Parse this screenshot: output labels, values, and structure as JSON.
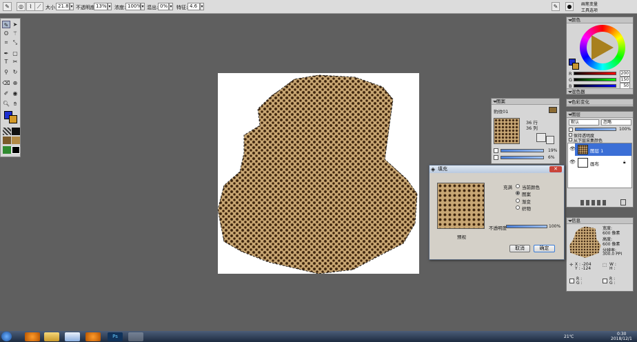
{
  "options_bar": {
    "size_label": "大小:",
    "size_value": "21.8",
    "opacity_label": "不透明度:",
    "opacity_value": "13%",
    "density_label": "浓度:",
    "density_value": "100%",
    "mix_label": "混出:",
    "mix_value": "0%",
    "feature_label": "特征:",
    "feature_value": "4.6"
  },
  "top_right": {
    "line1": "画笔变量",
    "line2": "工具选项"
  },
  "color_panel": {
    "title": "颜色",
    "r_label": "R",
    "r_value": "200",
    "g_label": "G",
    "g_value": "150",
    "b_label": "B",
    "b_value": "50",
    "mixer_label": "混色器",
    "primary_color": "#c89632"
  },
  "color_variation_panel": {
    "title": "色彩变化"
  },
  "pattern_panel": {
    "title": "图案",
    "name": "豹纹01",
    "rows": "36 行",
    "cols": "36 列",
    "slider1_value": "19%",
    "slider2_value": "6%"
  },
  "layers_panel": {
    "title": "图层",
    "blend_mode": "默认",
    "composite": "忽略",
    "opacity_value": "100%",
    "option1": "保持透明度",
    "option2": "从下层采集颜色",
    "layer1_name": "图层 1",
    "layer2_name": "画布"
  },
  "info_panel": {
    "title": "信息",
    "width_label": "宽度:",
    "width_value": "600 像素",
    "height_label": "高度:",
    "height_value": "600 像素",
    "res_label": "分辨率:",
    "res_value": "300.0 PPI",
    "x_value": "X : -204",
    "y_value": "Y : -124",
    "w_label": "W :",
    "h_label": "H :"
  },
  "dialog": {
    "title": "填充",
    "fill_label": "充满",
    "opt1": "当前颜色",
    "opt2": "图案",
    "opt3": "渐变",
    "opt4": "织物",
    "selected": "图案",
    "preview_label": "预视",
    "opacity_label": "不透明度",
    "opacity_value": "100%",
    "cancel_label": "取消",
    "ok_label": "确定"
  },
  "taskbar": {
    "temp": "21℃",
    "time": "0:30",
    "date": "2018/12/1"
  }
}
